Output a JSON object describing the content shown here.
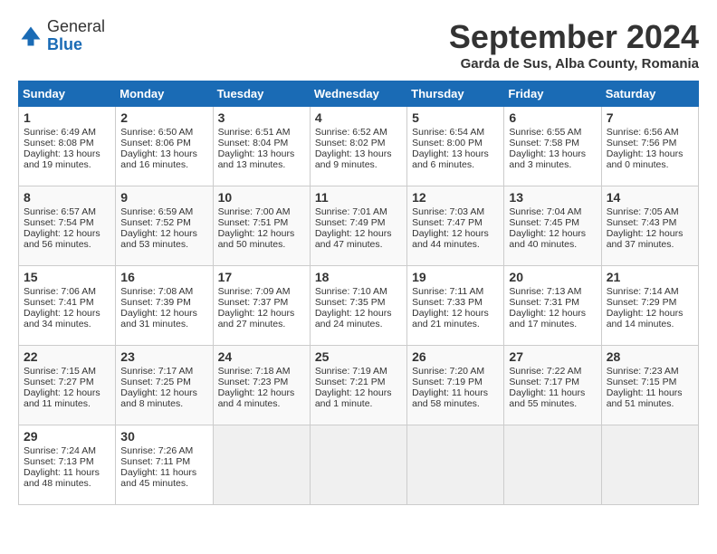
{
  "header": {
    "logo_line1": "General",
    "logo_line2": "Blue",
    "month_title": "September 2024",
    "location": "Garda de Sus, Alba County, Romania"
  },
  "days_of_week": [
    "Sunday",
    "Monday",
    "Tuesday",
    "Wednesday",
    "Thursday",
    "Friday",
    "Saturday"
  ],
  "weeks": [
    [
      {
        "day": 1,
        "lines": [
          "Sunrise: 6:49 AM",
          "Sunset: 8:08 PM",
          "Daylight: 13 hours",
          "and 19 minutes."
        ]
      },
      {
        "day": 2,
        "lines": [
          "Sunrise: 6:50 AM",
          "Sunset: 8:06 PM",
          "Daylight: 13 hours",
          "and 16 minutes."
        ]
      },
      {
        "day": 3,
        "lines": [
          "Sunrise: 6:51 AM",
          "Sunset: 8:04 PM",
          "Daylight: 13 hours",
          "and 13 minutes."
        ]
      },
      {
        "day": 4,
        "lines": [
          "Sunrise: 6:52 AM",
          "Sunset: 8:02 PM",
          "Daylight: 13 hours",
          "and 9 minutes."
        ]
      },
      {
        "day": 5,
        "lines": [
          "Sunrise: 6:54 AM",
          "Sunset: 8:00 PM",
          "Daylight: 13 hours",
          "and 6 minutes."
        ]
      },
      {
        "day": 6,
        "lines": [
          "Sunrise: 6:55 AM",
          "Sunset: 7:58 PM",
          "Daylight: 13 hours",
          "and 3 minutes."
        ]
      },
      {
        "day": 7,
        "lines": [
          "Sunrise: 6:56 AM",
          "Sunset: 7:56 PM",
          "Daylight: 13 hours",
          "and 0 minutes."
        ]
      }
    ],
    [
      {
        "day": 8,
        "lines": [
          "Sunrise: 6:57 AM",
          "Sunset: 7:54 PM",
          "Daylight: 12 hours",
          "and 56 minutes."
        ]
      },
      {
        "day": 9,
        "lines": [
          "Sunrise: 6:59 AM",
          "Sunset: 7:52 PM",
          "Daylight: 12 hours",
          "and 53 minutes."
        ]
      },
      {
        "day": 10,
        "lines": [
          "Sunrise: 7:00 AM",
          "Sunset: 7:51 PM",
          "Daylight: 12 hours",
          "and 50 minutes."
        ]
      },
      {
        "day": 11,
        "lines": [
          "Sunrise: 7:01 AM",
          "Sunset: 7:49 PM",
          "Daylight: 12 hours",
          "and 47 minutes."
        ]
      },
      {
        "day": 12,
        "lines": [
          "Sunrise: 7:03 AM",
          "Sunset: 7:47 PM",
          "Daylight: 12 hours",
          "and 44 minutes."
        ]
      },
      {
        "day": 13,
        "lines": [
          "Sunrise: 7:04 AM",
          "Sunset: 7:45 PM",
          "Daylight: 12 hours",
          "and 40 minutes."
        ]
      },
      {
        "day": 14,
        "lines": [
          "Sunrise: 7:05 AM",
          "Sunset: 7:43 PM",
          "Daylight: 12 hours",
          "and 37 minutes."
        ]
      }
    ],
    [
      {
        "day": 15,
        "lines": [
          "Sunrise: 7:06 AM",
          "Sunset: 7:41 PM",
          "Daylight: 12 hours",
          "and 34 minutes."
        ]
      },
      {
        "day": 16,
        "lines": [
          "Sunrise: 7:08 AM",
          "Sunset: 7:39 PM",
          "Daylight: 12 hours",
          "and 31 minutes."
        ]
      },
      {
        "day": 17,
        "lines": [
          "Sunrise: 7:09 AM",
          "Sunset: 7:37 PM",
          "Daylight: 12 hours",
          "and 27 minutes."
        ]
      },
      {
        "day": 18,
        "lines": [
          "Sunrise: 7:10 AM",
          "Sunset: 7:35 PM",
          "Daylight: 12 hours",
          "and 24 minutes."
        ]
      },
      {
        "day": 19,
        "lines": [
          "Sunrise: 7:11 AM",
          "Sunset: 7:33 PM",
          "Daylight: 12 hours",
          "and 21 minutes."
        ]
      },
      {
        "day": 20,
        "lines": [
          "Sunrise: 7:13 AM",
          "Sunset: 7:31 PM",
          "Daylight: 12 hours",
          "and 17 minutes."
        ]
      },
      {
        "day": 21,
        "lines": [
          "Sunrise: 7:14 AM",
          "Sunset: 7:29 PM",
          "Daylight: 12 hours",
          "and 14 minutes."
        ]
      }
    ],
    [
      {
        "day": 22,
        "lines": [
          "Sunrise: 7:15 AM",
          "Sunset: 7:27 PM",
          "Daylight: 12 hours",
          "and 11 minutes."
        ]
      },
      {
        "day": 23,
        "lines": [
          "Sunrise: 7:17 AM",
          "Sunset: 7:25 PM",
          "Daylight: 12 hours",
          "and 8 minutes."
        ]
      },
      {
        "day": 24,
        "lines": [
          "Sunrise: 7:18 AM",
          "Sunset: 7:23 PM",
          "Daylight: 12 hours",
          "and 4 minutes."
        ]
      },
      {
        "day": 25,
        "lines": [
          "Sunrise: 7:19 AM",
          "Sunset: 7:21 PM",
          "Daylight: 12 hours",
          "and 1 minute."
        ]
      },
      {
        "day": 26,
        "lines": [
          "Sunrise: 7:20 AM",
          "Sunset: 7:19 PM",
          "Daylight: 11 hours",
          "and 58 minutes."
        ]
      },
      {
        "day": 27,
        "lines": [
          "Sunrise: 7:22 AM",
          "Sunset: 7:17 PM",
          "Daylight: 11 hours",
          "and 55 minutes."
        ]
      },
      {
        "day": 28,
        "lines": [
          "Sunrise: 7:23 AM",
          "Sunset: 7:15 PM",
          "Daylight: 11 hours",
          "and 51 minutes."
        ]
      }
    ],
    [
      {
        "day": 29,
        "lines": [
          "Sunrise: 7:24 AM",
          "Sunset: 7:13 PM",
          "Daylight: 11 hours",
          "and 48 minutes."
        ]
      },
      {
        "day": 30,
        "lines": [
          "Sunrise: 7:26 AM",
          "Sunset: 7:11 PM",
          "Daylight: 11 hours",
          "and 45 minutes."
        ]
      },
      null,
      null,
      null,
      null,
      null
    ]
  ]
}
